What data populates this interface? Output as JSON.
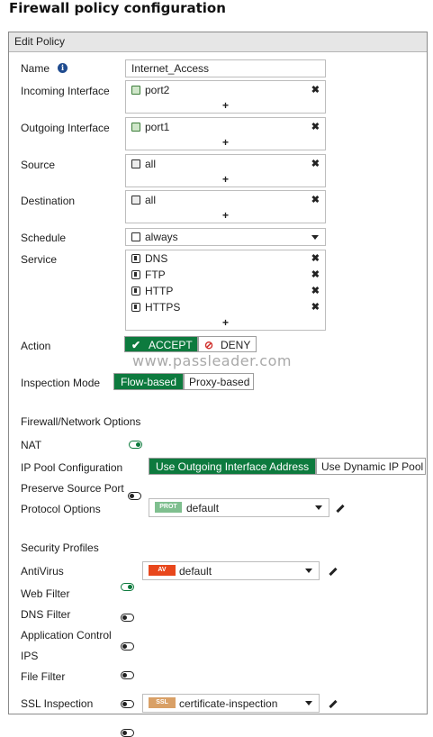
{
  "page_title": "Firewall policy configuration",
  "panel": {
    "title": "Edit Policy"
  },
  "name": {
    "label": "Name",
    "value": "Internet_Access"
  },
  "incoming": {
    "label": "Incoming Interface",
    "value": "port2"
  },
  "outgoing": {
    "label": "Outgoing Interface",
    "value": "port1"
  },
  "source": {
    "label": "Source",
    "value": "all"
  },
  "destination": {
    "label": "Destination",
    "value": "all"
  },
  "schedule": {
    "label": "Schedule",
    "value": "always"
  },
  "service": {
    "label": "Service",
    "items": [
      "DNS",
      "FTP",
      "HTTP",
      "HTTPS"
    ]
  },
  "action": {
    "label": "Action",
    "accept": "ACCEPT",
    "deny": "DENY",
    "selected": "ACCEPT"
  },
  "watermark": "www.passleader.com",
  "inspection": {
    "label": "Inspection Mode",
    "flow": "Flow-based",
    "proxy": "Proxy-based",
    "selected": "Flow-based"
  },
  "fw_options": {
    "title": "Firewall/Network Options",
    "nat_label": "NAT",
    "nat_enabled": true,
    "ip_pool_label": "IP Pool Configuration",
    "ip_pool_outgoing": "Use Outgoing Interface Address",
    "ip_pool_dynamic": "Use Dynamic IP Pool",
    "preserve_label": "Preserve Source Port",
    "preserve_enabled": false,
    "protocol_label": "Protocol Options",
    "protocol_badge": "PROT",
    "protocol_value": "default"
  },
  "security": {
    "title": "Security Profiles",
    "antivirus": {
      "label": "AntiVirus",
      "enabled": true,
      "badge": "AV",
      "value": "default"
    },
    "web_filter": {
      "label": "Web Filter",
      "enabled": false
    },
    "dns_filter": {
      "label": "DNS Filter",
      "enabled": false
    },
    "app_control": {
      "label": "Application Control",
      "enabled": false
    },
    "ips": {
      "label": "IPS",
      "enabled": false
    },
    "file_filter": {
      "label": "File Filter",
      "enabled": false
    },
    "ssl": {
      "label": "SSL Inspection",
      "badge": "SSL",
      "value": "certificate-inspection"
    }
  },
  "colors": {
    "accent_green": "#0d7a3e",
    "deny_red": "#d0312d",
    "av_badge": "#e8471c",
    "prot_badge": "#7fbf8f",
    "ssl_badge": "#d9a066",
    "info_blue": "#1f4b8f"
  },
  "icons": [
    "info-icon",
    "port-icon",
    "address-icon",
    "schedule-icon",
    "service-icon",
    "close-icon",
    "plus-icon",
    "chevron-down-icon",
    "pencil-icon",
    "check-icon",
    "deny-icon"
  ]
}
